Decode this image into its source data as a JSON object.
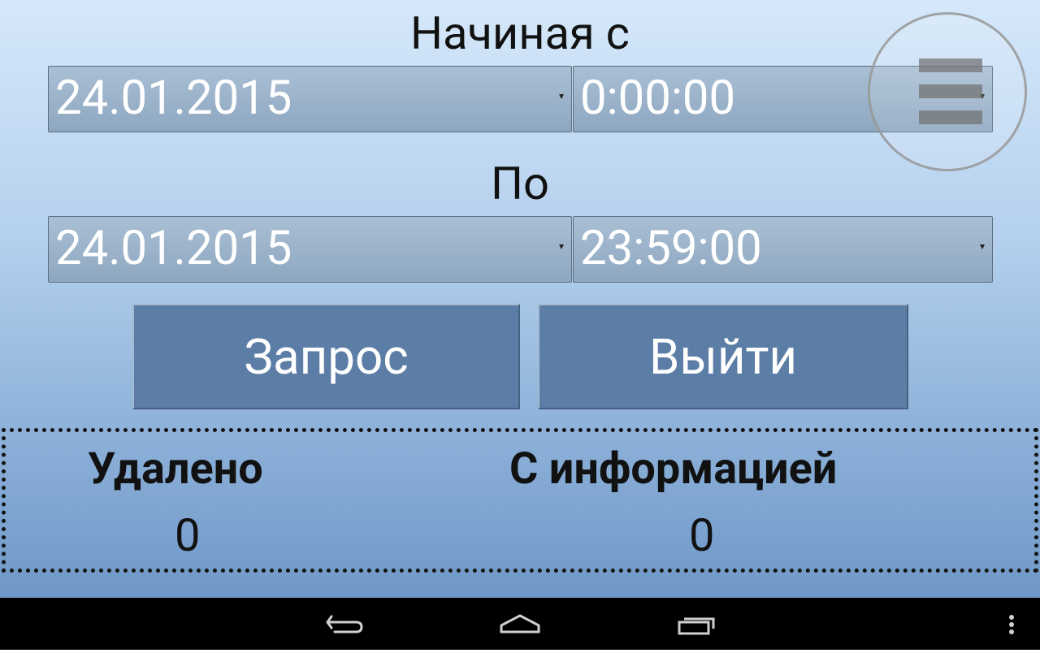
{
  "from": {
    "heading": "Начиная с",
    "date": "24.01.2015",
    "time": "0:00:00"
  },
  "to": {
    "heading": "По",
    "date": "24.01.2015",
    "time": "23:59:00"
  },
  "buttons": {
    "query": "Запрос",
    "exit": "Выйти"
  },
  "results": {
    "deleted_label": "Удалено",
    "deleted_value": "0",
    "with_info_label": "С информацией",
    "with_info_value": "0"
  },
  "icons": {
    "menu": "menu-icon",
    "back": "back-icon",
    "home": "home-icon",
    "recents": "recents-icon",
    "overflow": "overflow-icon"
  },
  "colors": {
    "button_bg": "#5c7ea6",
    "spinner_bg": "#9bb2ca",
    "navbar_bg": "#000000"
  }
}
